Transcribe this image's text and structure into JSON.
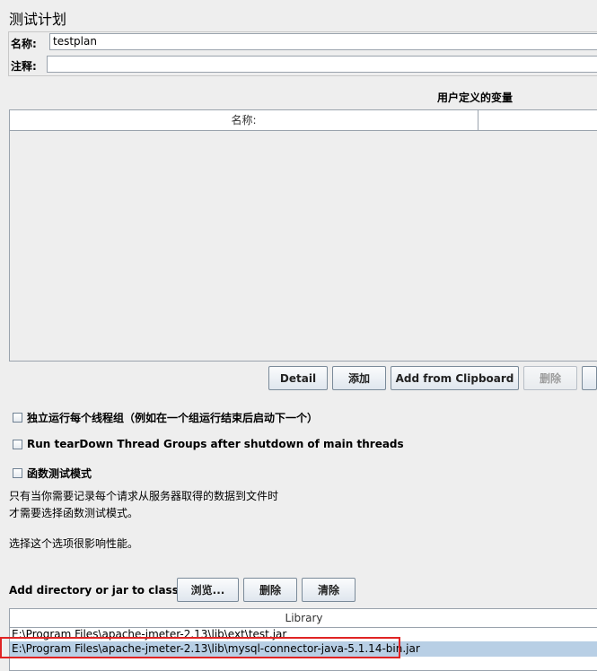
{
  "panel": {
    "title": "测试计划"
  },
  "form": {
    "name_label": "名称:",
    "name_value": "testplan",
    "comment_label": "注释:",
    "comment_value": ""
  },
  "variables": {
    "section_title": "用户定义的变量",
    "columns": [
      "名称:",
      ""
    ],
    "buttons": {
      "detail": "Detail",
      "add": "添加",
      "add_clipboard": "Add from Clipboard",
      "delete": "删除"
    }
  },
  "options": {
    "run_sequential": "独立运行每个线程组（例如在一个组运行结束后启动下一个）",
    "teardown": "Run tearDown Thread Groups after shutdown of main threads",
    "functional_mode": "函数测试模式",
    "functional_note_line1": "只有当你需要记录每个请求从服务器取得的数据到文件时",
    "functional_note_line2": "才需要选择函数测试模式。",
    "performance_note": "选择这个选项很影响性能。"
  },
  "classpath": {
    "label": "Add directory or jar to classpath",
    "browse": "浏览...",
    "delete": "删除",
    "clear": "清除",
    "column": "Library",
    "rows": [
      "E:\\Program Files\\apache-jmeter-2.13\\lib\\ext\\test.jar",
      "E:\\Program Files\\apache-jmeter-2.13\\lib\\mysql-connector-java-5.1.14-bin.jar"
    ]
  }
}
